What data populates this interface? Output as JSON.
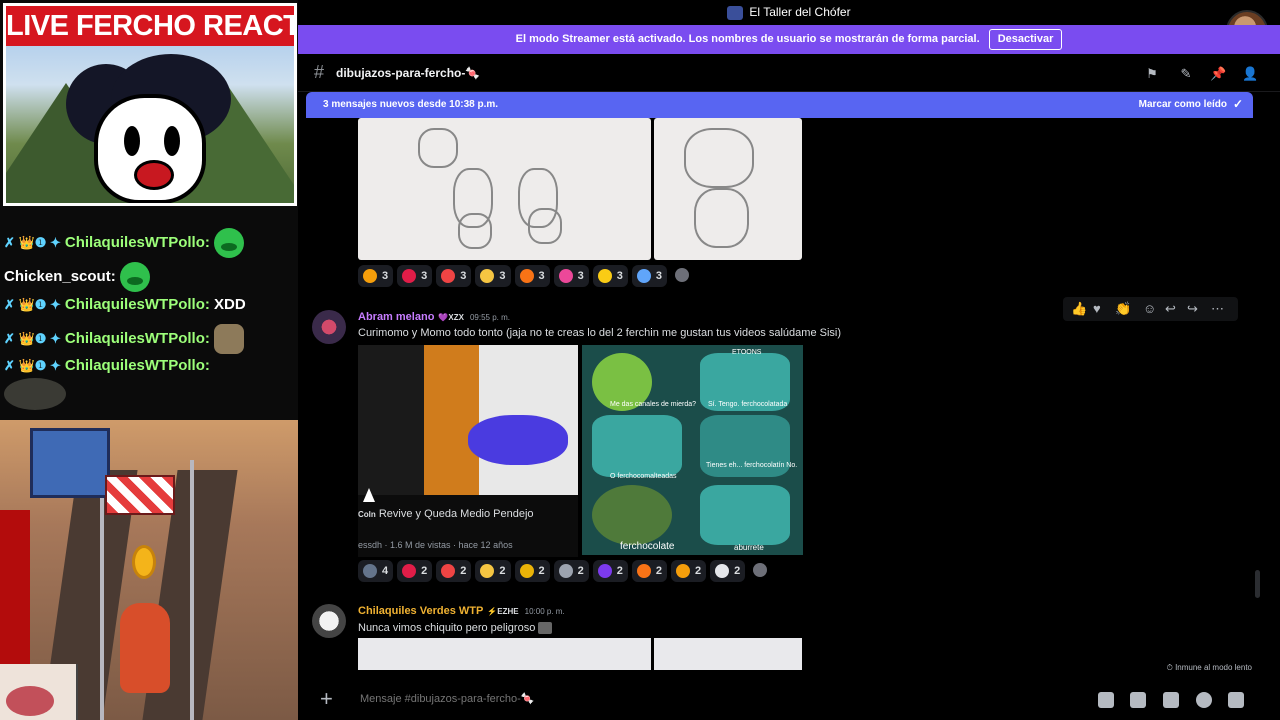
{
  "overlay": {
    "title": "LIVE FERCHO REACTION",
    "chat": [
      {
        "badges": "✗ 👑❶ ✦",
        "user": "ChilaquilesWTPollo:",
        "message": "",
        "emote": "crying-frog-emote"
      },
      {
        "badges": "",
        "user": "Chicken_scout:",
        "message": "",
        "emote": "crying-frog-emote"
      },
      {
        "badges": "✗ 👑❶ ✦",
        "user": "ChilaquilesWTPollo:",
        "message": "XDD",
        "emote": ""
      },
      {
        "badges": "✗ 👑❶ ✦",
        "user": "ChilaquilesWTPollo:",
        "message": "",
        "emote": "monkey-emote"
      },
      {
        "badges": "✗ 👑❶ ✦",
        "user": "ChilaquilesWTPollo:",
        "message": "",
        "emote": "seal-emote"
      }
    ]
  },
  "window": {
    "title": "El Taller del Chófer"
  },
  "streamer_bar": {
    "text": "El modo Streamer está activado. Los nombres de usuario se mostrarán de forma parcial.",
    "button": "Desactivar"
  },
  "channel": {
    "name": "dibujazos-para-fercho-🍬"
  },
  "new_messages": {
    "text": "3 mensajes nuevos desde 10:38 p.m.",
    "action": "Marcar como leído"
  },
  "reactions_row1": [
    {
      "count": "3",
      "color": "#f59e0b"
    },
    {
      "count": "3",
      "color": "#e11d48"
    },
    {
      "count": "3",
      "color": "#ef4444"
    },
    {
      "count": "3",
      "color": "#f5c542"
    },
    {
      "count": "3",
      "color": "#f97316"
    },
    {
      "count": "3",
      "color": "#ec4899"
    },
    {
      "count": "3",
      "color": "#facc15"
    },
    {
      "count": "3",
      "color": "#60a5fa"
    }
  ],
  "message1": {
    "author": "Abram melano",
    "tag": "💜XZX",
    "time": "09:55 p. m.",
    "text": "Curimomo y Momo todo tonto (jaja no te creas lo del 2 ferchin me gustan tus videos salúdame Sisi)",
    "embed_title": "Revive y Queda Medio Pendejo",
    "embed_prefix": "Coln",
    "embed_meta": "essdh · 1.6 M de vistas · hace 12 años",
    "meme_captions": [
      "Me das canales de mierda?",
      "Sí. Tengo. ferchocolatada",
      "O ferchocomalteadas",
      "Tienes eh... ferchocolatín No.",
      "ferchocolate",
      "aburrete"
    ],
    "meme_badge": "ETOONS"
  },
  "reactions_row2": [
    {
      "count": "4",
      "color": "#64748b"
    },
    {
      "count": "2",
      "color": "#e11d48"
    },
    {
      "count": "2",
      "color": "#ef4444"
    },
    {
      "count": "2",
      "color": "#f5c542"
    },
    {
      "count": "2",
      "color": "#eab308"
    },
    {
      "count": "2",
      "color": "#9ca3af"
    },
    {
      "count": "2",
      "color": "#7c3aed"
    },
    {
      "count": "2",
      "color": "#f97316"
    },
    {
      "count": "2",
      "color": "#f59e0b"
    },
    {
      "count": "2",
      "color": "#e5e7eb"
    }
  ],
  "message2": {
    "author": "Chilaquiles Verdes WTP",
    "tag": "⚡EZHE",
    "time": "10:00 p. m.",
    "text": "Nunca vimos chiquito pero peligroso"
  },
  "slowmode": "Inmune al modo lento",
  "composer": {
    "placeholder": "Mensaje #dibujazos-para-fercho-🍬"
  },
  "colors": {
    "accent": "#5865f2",
    "streamer": "#7a4cf0",
    "author1": "#c77dff",
    "author2": "#f0b232"
  }
}
